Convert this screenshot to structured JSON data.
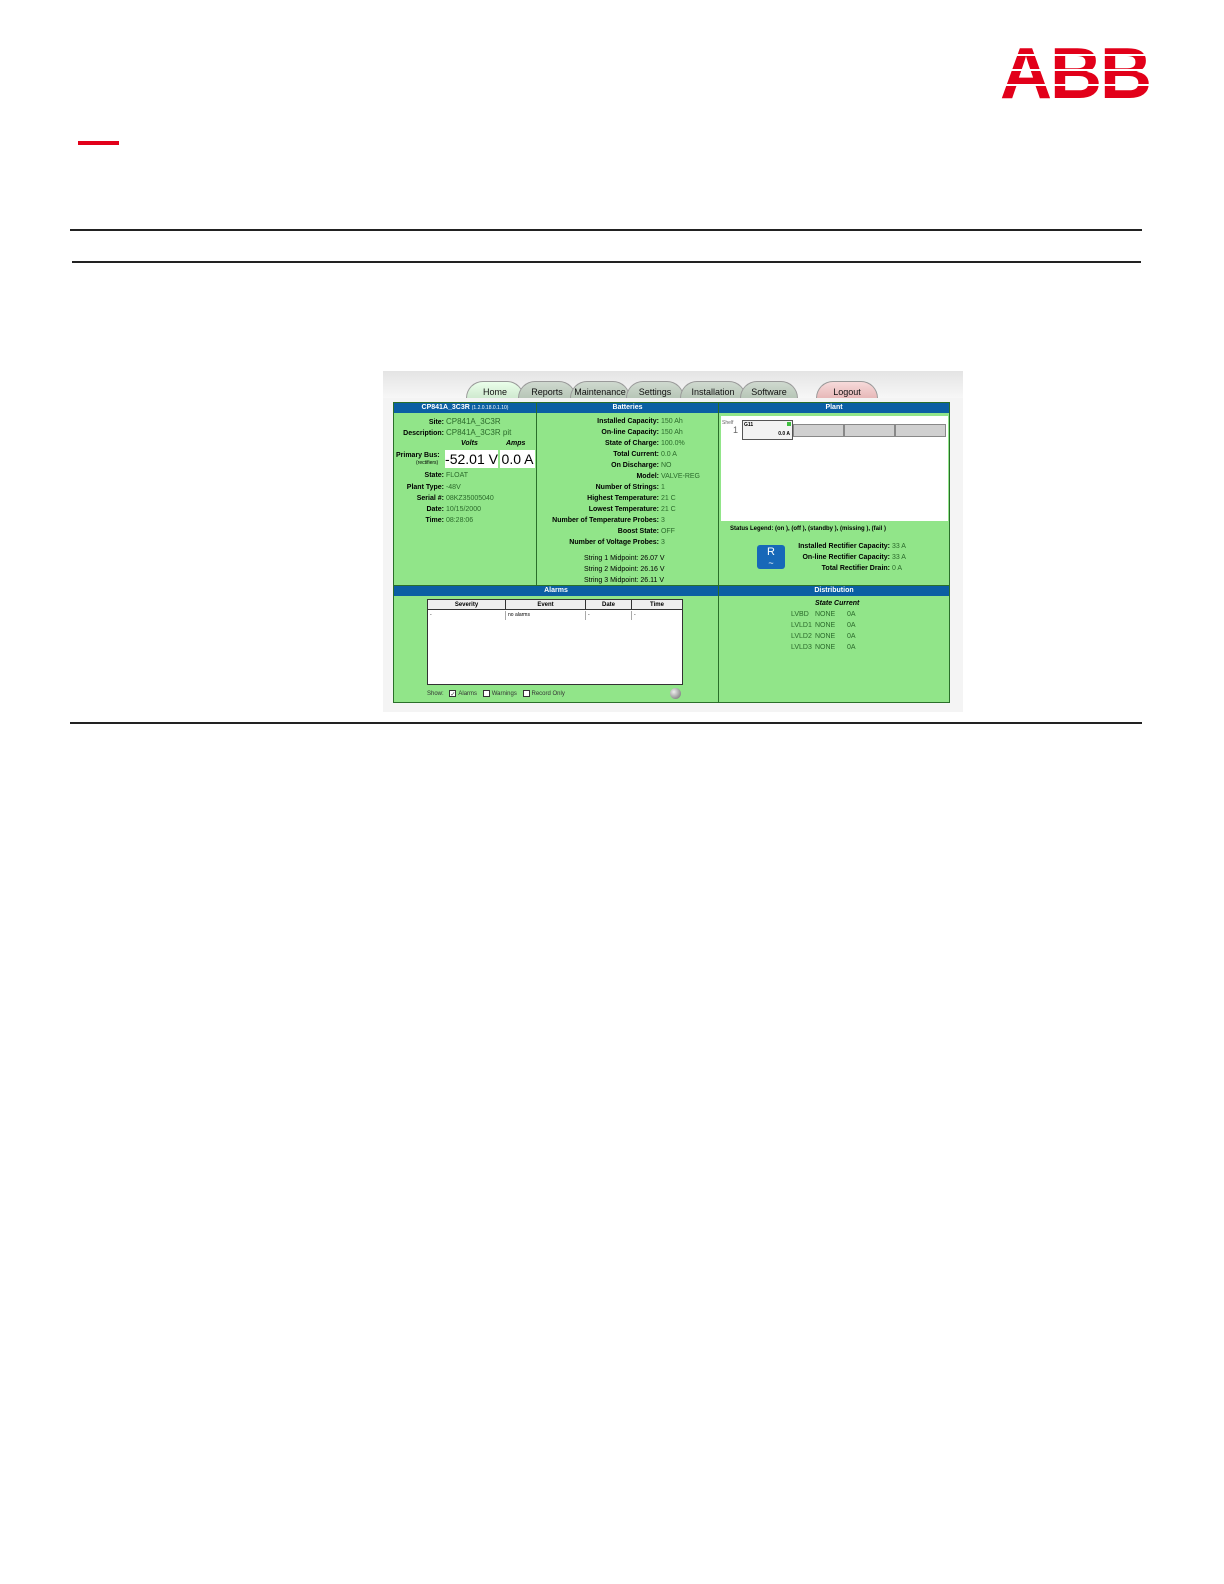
{
  "brand": {
    "logo_text": "ABB",
    "accent": "#e2001a"
  },
  "tabs": [
    {
      "label": "Home"
    },
    {
      "label": "Reports"
    },
    {
      "label": "Maintenance"
    },
    {
      "label": "Settings"
    },
    {
      "label": "Installation"
    },
    {
      "label": "Software"
    },
    {
      "label": "Logout"
    }
  ],
  "controller": {
    "header": "CP841A_3C3R",
    "ip": "(1.2.0.18.0.1.10)",
    "site_label": "Site:",
    "site": "CP841A_3C3R",
    "description_label": "Description:",
    "description": "CP841A_3C3R pit",
    "volts_label": "Volts",
    "amps_label": "Amps",
    "primary_bus_label": "Primary Bus:",
    "rectifiers_label": "(rectifiers)",
    "volts": "-52.01 V",
    "amps": "0.0 A",
    "state_label": "State:",
    "state": "FLOAT",
    "plant_type_label": "Plant Type:",
    "plant_type": "-48V",
    "serial_label": "Serial #:",
    "serial": "08KZ35005040",
    "date_label": "Date:",
    "date": "10/15/2000",
    "time_label": "Time:",
    "time": "08:28:06"
  },
  "batteries": {
    "header": "Batteries",
    "rows": [
      {
        "label": "Installed Capacity:",
        "value": "150 Ah"
      },
      {
        "label": "On-line Capacity:",
        "value": "150 Ah"
      },
      {
        "label": "State of Charge:",
        "value": "100.0%"
      },
      {
        "label": "Total Current:",
        "value": "0.0 A"
      },
      {
        "label": "On Discharge:",
        "value": "NO"
      },
      {
        "label": "Model:",
        "value": "VALVE-REG"
      },
      {
        "label": "Number of Strings:",
        "value": "1"
      },
      {
        "label": "Highest Temperature:",
        "value": "21 C"
      },
      {
        "label": "Lowest Temperature:",
        "value": "21 C"
      },
      {
        "label": "Number of Temperature Probes:",
        "value": "3"
      },
      {
        "label": "Boost State:",
        "value": "OFF"
      },
      {
        "label": "Number of Voltage Probes:",
        "value": "3"
      }
    ],
    "midpoints": [
      "String 1 Midpoint: 26.07 V",
      "String 2 Midpoint: 26.16 V",
      "String 3 Midpoint: 26.11 V"
    ]
  },
  "plant": {
    "header": "Plant",
    "shelf_label": "Shelf",
    "shelf_num": "1",
    "rect_id": "G11",
    "rect_current": "0.0 A",
    "legend": "Status Legend: (on ), (off ), (standby ), (missing ), (fail )",
    "r_icon_label": "R",
    "rows": [
      {
        "label": "Installed Rectifier Capacity:",
        "value": "33 A"
      },
      {
        "label": "On-line Rectifier Capacity:",
        "value": "33 A"
      },
      {
        "label": "Total Rectifier Drain:",
        "value": "0 A"
      }
    ]
  },
  "alarms": {
    "header": "Alarms",
    "columns": [
      "Severity",
      "Event",
      "Date",
      "Time"
    ],
    "row": [
      "-",
      "no alarms",
      "-",
      "-"
    ],
    "show_label": "Show:",
    "filters": [
      {
        "label": "Alarms",
        "checked": true
      },
      {
        "label": "Warnings",
        "checked": false
      },
      {
        "label": "Record Only",
        "checked": false
      }
    ]
  },
  "distribution": {
    "header": "Distribution",
    "columns_label": "State Current",
    "rows": [
      {
        "name": "LVBD",
        "state": "NONE",
        "current": "0A"
      },
      {
        "name": "LVLD1",
        "state": "NONE",
        "current": "0A"
      },
      {
        "name": "LVLD2",
        "state": "NONE",
        "current": "0A"
      },
      {
        "name": "LVLD3",
        "state": "NONE",
        "current": "0A"
      }
    ]
  }
}
